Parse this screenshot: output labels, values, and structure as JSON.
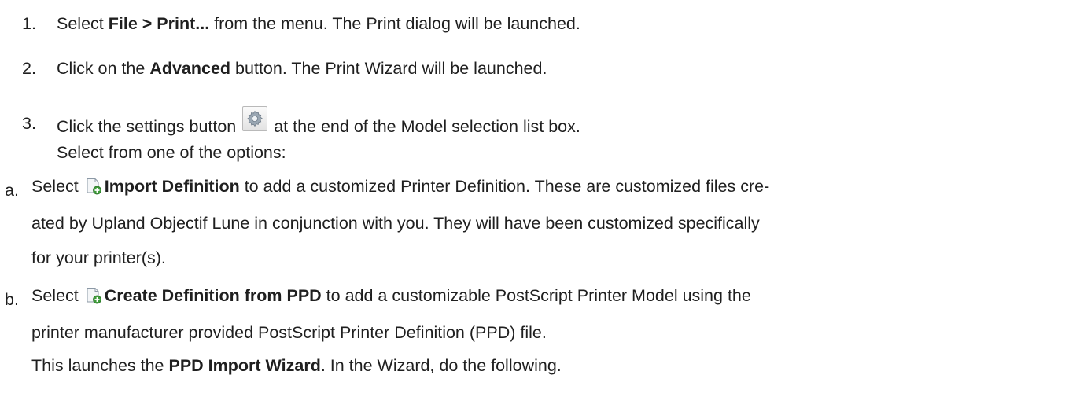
{
  "steps": [
    {
      "num": "1.",
      "pre": "Select ",
      "bold": "File > Print...",
      "post": " from the menu. The Print dialog will be launched."
    },
    {
      "num": "2.",
      "pre": "Click on the ",
      "bold": "Advanced",
      "post": " button. The Print Wizard will be launched."
    },
    {
      "num": "3.",
      "pre": "Click the settings button ",
      "post": " at the end of the Model selection list box.",
      "sub": "Select from one of the options:",
      "icon": "settings-gear-icon"
    }
  ],
  "options": [
    {
      "letter": "a.",
      "pre": "Select ",
      "icon": "add-definition-icon",
      "bold": "Import Definition",
      "lines": [
        " to add a customized Printer Definition. These are customized files cre-",
        "ated by Upland Objectif Lune in conjunction with you. They will have been customized specifically",
        "for your printer(s)."
      ]
    },
    {
      "letter": "b.",
      "pre": "Select ",
      "icon": "add-definition-icon",
      "bold": "Create Definition from PPD",
      "lines": [
        " to add a customizable PostScript Printer Model using the",
        "printer manufacturer provided PostScript Printer Definition (PPD) file."
      ],
      "note_pre": "This launches the ",
      "note_bold": "PPD Import Wizard",
      "note_post": ". In the Wizard, do the following."
    }
  ]
}
